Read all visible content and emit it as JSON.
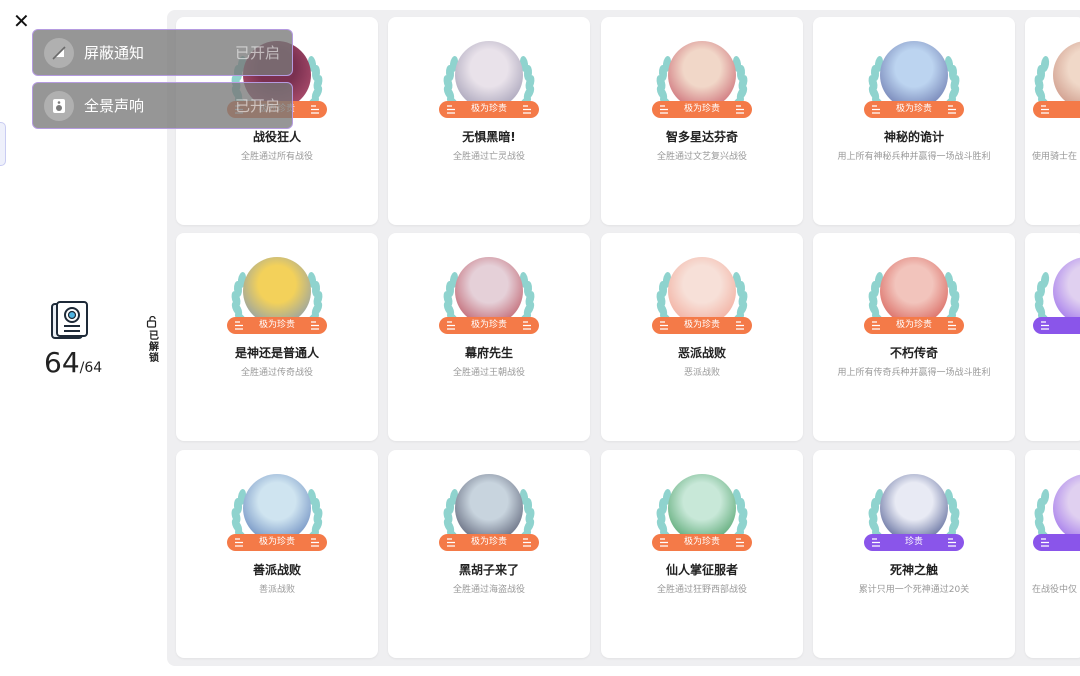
{
  "close": "✕",
  "summary": {
    "unlocked": "64",
    "total": "/64"
  },
  "filter": {
    "label": "已解锁"
  },
  "toasts": [
    {
      "label": "屏蔽通知",
      "state": "已开启",
      "icon": "bell-off-icon"
    },
    {
      "label": "全景声响",
      "state": "已开启",
      "icon": "speaker-icon"
    }
  ],
  "colors": {
    "orange": "#f47a48",
    "purple": "#8a55ea",
    "leaf": "#8fd3ce",
    "panel": "#efeff1"
  },
  "achievements": [
    {
      "title": "战役狂人",
      "desc": "全胜通过所有战役",
      "rarity": "极为珍贵",
      "tier": "orange"
    },
    {
      "title": "无惧黑暗!",
      "desc": "全胜通过亡灵战役",
      "rarity": "极为珍贵",
      "tier": "orange"
    },
    {
      "title": "智多星达芬奇",
      "desc": "全胜通过文艺复兴战役",
      "rarity": "极为珍贵",
      "tier": "orange"
    },
    {
      "title": "神秘的诡计",
      "desc": "用上所有神秘兵种并赢得一场战斗胜利",
      "rarity": "极为珍贵",
      "tier": "orange"
    },
    {
      "title": "",
      "desc": "使用骑士在",
      "rarity": "",
      "tier": "orange"
    },
    {
      "title": "是神还是普通人",
      "desc": "全胜通过传奇战役",
      "rarity": "极为珍贵",
      "tier": "orange"
    },
    {
      "title": "幕府先生",
      "desc": "全胜通过王朝战役",
      "rarity": "极为珍贵",
      "tier": "orange"
    },
    {
      "title": "恶派战败",
      "desc": "恶派战败",
      "rarity": "极为珍贵",
      "tier": "orange"
    },
    {
      "title": "不朽传奇",
      "desc": "用上所有传奇兵种并赢得一场战斗胜利",
      "rarity": "极为珍贵",
      "tier": "orange"
    },
    {
      "title": "",
      "desc": "",
      "rarity": "",
      "tier": "purple"
    },
    {
      "title": "善派战败",
      "desc": "善派战败",
      "rarity": "极为珍贵",
      "tier": "orange"
    },
    {
      "title": "黑胡子来了",
      "desc": "全胜通过海盗战役",
      "rarity": "极为珍贵",
      "tier": "orange"
    },
    {
      "title": "仙人掌征服者",
      "desc": "全胜通过狂野西部战役",
      "rarity": "极为珍贵",
      "tier": "orange"
    },
    {
      "title": "死神之触",
      "desc": "累计只用一个死神通过20关",
      "rarity": "珍贵",
      "tier": "purple"
    },
    {
      "title": "",
      "desc": "在战役中仅",
      "rarity": "",
      "tier": "purple"
    }
  ]
}
